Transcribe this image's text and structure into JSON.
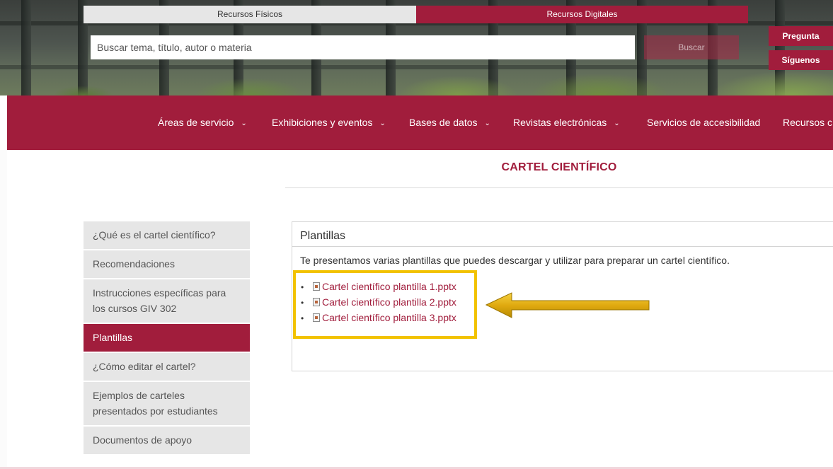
{
  "header": {
    "tab_fisicos": "Recursos Físicos",
    "tab_digitales": "Recursos Digitales",
    "search_placeholder": "Buscar tema, título, autor o materia",
    "search_button": "Buscar",
    "side_button_1": "Pregunta",
    "side_button_2": "Síguenos"
  },
  "nav": {
    "items": [
      {
        "label": "Áreas de servicio",
        "dropdown": true
      },
      {
        "label": "Exhibiciones y eventos",
        "dropdown": true
      },
      {
        "label": "Bases de datos",
        "dropdown": true
      },
      {
        "label": "Revistas electrónicas",
        "dropdown": true
      },
      {
        "label": "Servicios de accesibilidad",
        "dropdown": false
      },
      {
        "label": "Recursos c",
        "dropdown": false
      }
    ]
  },
  "page": {
    "title": "CARTEL CIENTÍFICO"
  },
  "sidemenu": {
    "items": [
      {
        "label": "¿Qué es el cartel científico?",
        "active": false
      },
      {
        "label": "Recomendaciones",
        "active": false
      },
      {
        "label": "Instrucciones específicas para los cursos GIV 302",
        "active": false
      },
      {
        "label": "Plantillas",
        "active": true
      },
      {
        "label": "¿Cómo editar el cartel?",
        "active": false
      },
      {
        "label": "Ejemplos de carteles presentados por estudiantes",
        "active": false
      },
      {
        "label": "Documentos de apoyo",
        "active": false
      }
    ]
  },
  "panel": {
    "heading": "Plantillas",
    "description": "Te presentamos varias plantillas que puedes descargar y utilizar para preparar un cartel científico.",
    "files": [
      "Cartel científico plantilla 1.pptx",
      "Cartel científico plantilla 2.pptx",
      "Cartel científico plantilla 3.pptx"
    ]
  },
  "colors": {
    "brand": "#a11d3c",
    "highlight": "#f2c200",
    "arrow": "#d9a400"
  }
}
